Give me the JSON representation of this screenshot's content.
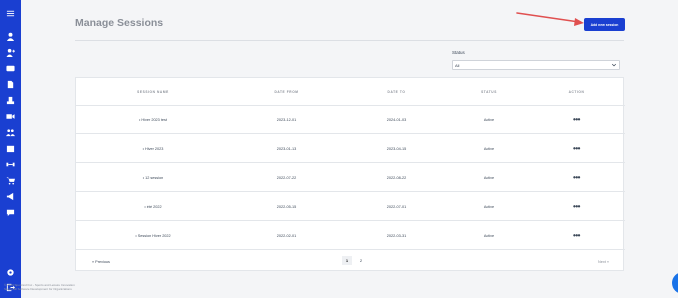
{
  "page": {
    "title": "Manage Sessions"
  },
  "toolbar": {
    "add_label": "Add new session"
  },
  "filter": {
    "label": "Status",
    "value": "All"
  },
  "table": {
    "headers": [
      "SESSION NAME",
      "DATE FROM",
      "DATE TO",
      "STATUS",
      "ACTION"
    ],
    "rows": [
      {
        "name": "Hiver 2023 test",
        "from": "2023-12-01",
        "to": "2024-01-03",
        "status": "Active",
        "action": "•••"
      },
      {
        "name": "Hiver 2023",
        "from": "2023-01-13",
        "to": "2023-04-15",
        "status": "Active",
        "action": "•••"
      },
      {
        "name": "12 session",
        "from": "2022-07-22",
        "to": "2022-08-22",
        "status": "Active",
        "action": "•••"
      },
      {
        "name": "été 2022",
        "from": "2022-05-15",
        "to": "2022-07-01",
        "status": "Active",
        "action": "•••"
      },
      {
        "name": "Session Hiver 2022",
        "from": "2022-02-01",
        "to": "2022-03-31",
        "status": "Active",
        "action": "•••"
      }
    ]
  },
  "pagination": {
    "prev": "« Previous",
    "page1": "1",
    "page2": "2",
    "next": "Next »"
  },
  "footer": {
    "line1": "© 2023 Sportnroll Inc - Sports and Leisure Innovation",
    "line2": "Sportnroll Software Development for Organizations"
  },
  "colors": {
    "brand": "#1a3fd1",
    "arrow": "#e05050",
    "chat": "#1a73e8"
  },
  "sidebar_icons": [
    "menu-icon",
    "user-icon",
    "user-plus-icon",
    "credit-card-icon",
    "document-icon",
    "hand-icon",
    "video-icon",
    "group-icon",
    "calendar-icon",
    "dumbbell-icon",
    "cart-icon",
    "megaphone-icon",
    "chat-bubble-icon",
    "settings-icon",
    "logout-icon"
  ]
}
